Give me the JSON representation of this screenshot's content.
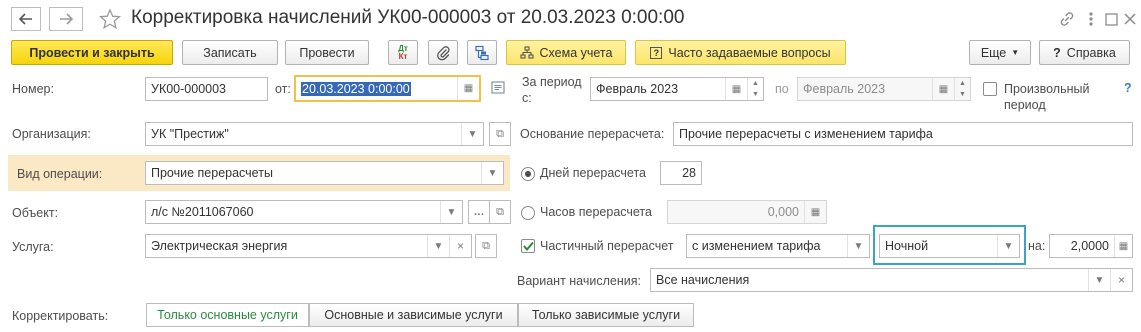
{
  "window": {
    "title": "Корректировка начислений УК00-000003 от 20.03.2023 0:00:00",
    "icons": [
      "arrow-left-icon",
      "arrow-right-icon",
      "star-icon",
      "link-icon",
      "more-vertical-icon",
      "maximize-icon",
      "close-icon"
    ]
  },
  "toolbar": {
    "post_close": "Провести и закрыть",
    "save": "Записать",
    "post": "Провести",
    "dt_kt_top": "Дт",
    "dt_kt_bottom": "Кт",
    "scheme": "Схема учета",
    "faq": "Часто задаваемые вопросы",
    "more": "Еще",
    "help": "Справка",
    "help_mark": "?",
    "colors": {
      "primary": "#f6d40a",
      "accent_yellow": "#fbe56b"
    }
  },
  "form": {
    "number": {
      "label": "Номер:",
      "value": "УК00-000003"
    },
    "date": {
      "label": "от:",
      "value": "20.03.2023  0:00:00"
    },
    "period_from": {
      "label_line1": "За период",
      "label_line2": "с:",
      "value": "Февраль 2023"
    },
    "period_to": {
      "label": "по",
      "value": "Февраль 2023"
    },
    "arbitrary_period": {
      "label_line1": "Произвольный",
      "label_line2": "период",
      "checked": false,
      "hint": "?"
    },
    "organization": {
      "label": "Организация:",
      "value": "УК \"Престиж\""
    },
    "basis": {
      "label": "Основание перерасчета:",
      "value": "Прочие перерасчеты с изменением тарифа"
    },
    "operation_type": {
      "label": "Вид операции:",
      "value": "Прочие перерасчеты",
      "highlight": "#fbe8c5"
    },
    "days": {
      "label": "Дней перерасчета",
      "value": "28",
      "selected": true
    },
    "hours": {
      "label": "Часов перерасчета",
      "value": "0,000",
      "selected": false
    },
    "object": {
      "label": "Объект:",
      "value": "л/с №2011067060"
    },
    "service": {
      "label": "Услуга:",
      "value": "Электрическая энергия"
    },
    "partial": {
      "label": "Частичный перерасчет",
      "checked": true,
      "mode": "с изменением тарифа",
      "zone": "Ночной",
      "zone_frame_color": "#3aa3c7"
    },
    "coefficient": {
      "label": "на:",
      "value": "2,0000"
    },
    "accrual_variant": {
      "label": "Вариант начисления:",
      "value": "Все начисления"
    },
    "correct": {
      "label": "Корректировать:",
      "tabs": [
        "Только основные услуги",
        "Основные и зависимые услуги",
        "Только зависимые услуги"
      ],
      "active": 0,
      "active_color": "#2a8a3e"
    }
  }
}
